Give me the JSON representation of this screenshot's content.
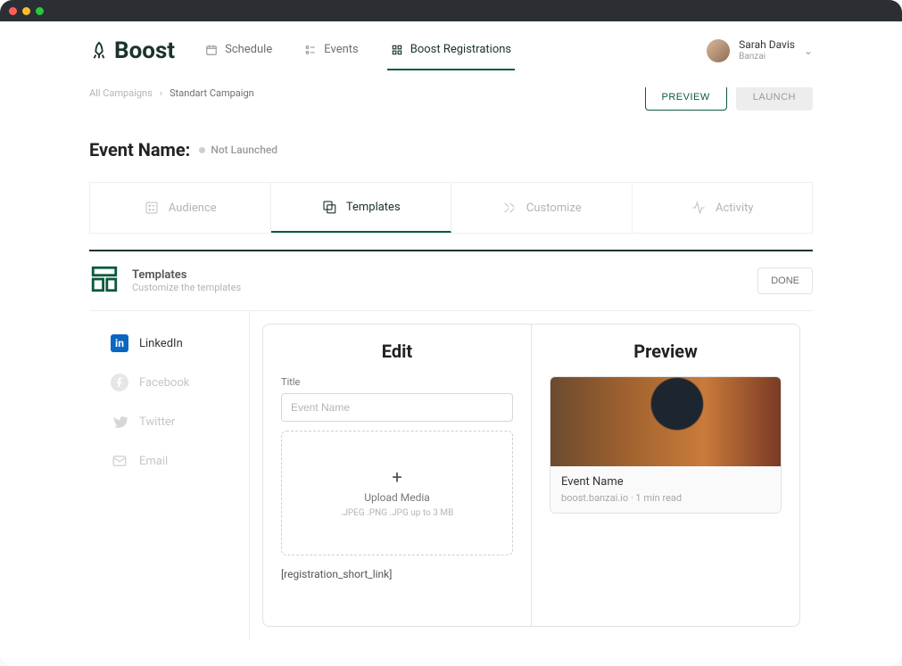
{
  "brand": "Boost",
  "nav": {
    "schedule": "Schedule",
    "events": "Events",
    "registrations": "Boost Registrations"
  },
  "user": {
    "name": "Sarah Davis",
    "org": "Banzai"
  },
  "breadcrumb": {
    "root": "All Campaigns",
    "current": "Standart Campaign"
  },
  "actions": {
    "preview": "PREVIEW",
    "launch": "LAUNCH",
    "done": "DONE"
  },
  "event": {
    "label": "Event Name:",
    "status": "Not Launched"
  },
  "tabs": {
    "audience": "Audience",
    "templates": "Templates",
    "customize": "Customize",
    "activity": "Activity"
  },
  "section": {
    "title": "Templates",
    "sub": "Customize the templates"
  },
  "channels": {
    "linkedin": "LinkedIn",
    "facebook": "Facebook",
    "twitter": "Twitter",
    "email": "Email"
  },
  "editor": {
    "editHead": "Edit",
    "previewHead": "Preview",
    "titleLabel": "Title",
    "titlePlaceholder": "Event Name",
    "uploadLine": "Upload Media",
    "uploadHint": ".JPEG .PNG .JPG up to 3 MB",
    "shortlink": "[registration_short_link]",
    "previewTitle": "Event Name",
    "previewSub": "boost.banzai.io · 1 min read"
  }
}
